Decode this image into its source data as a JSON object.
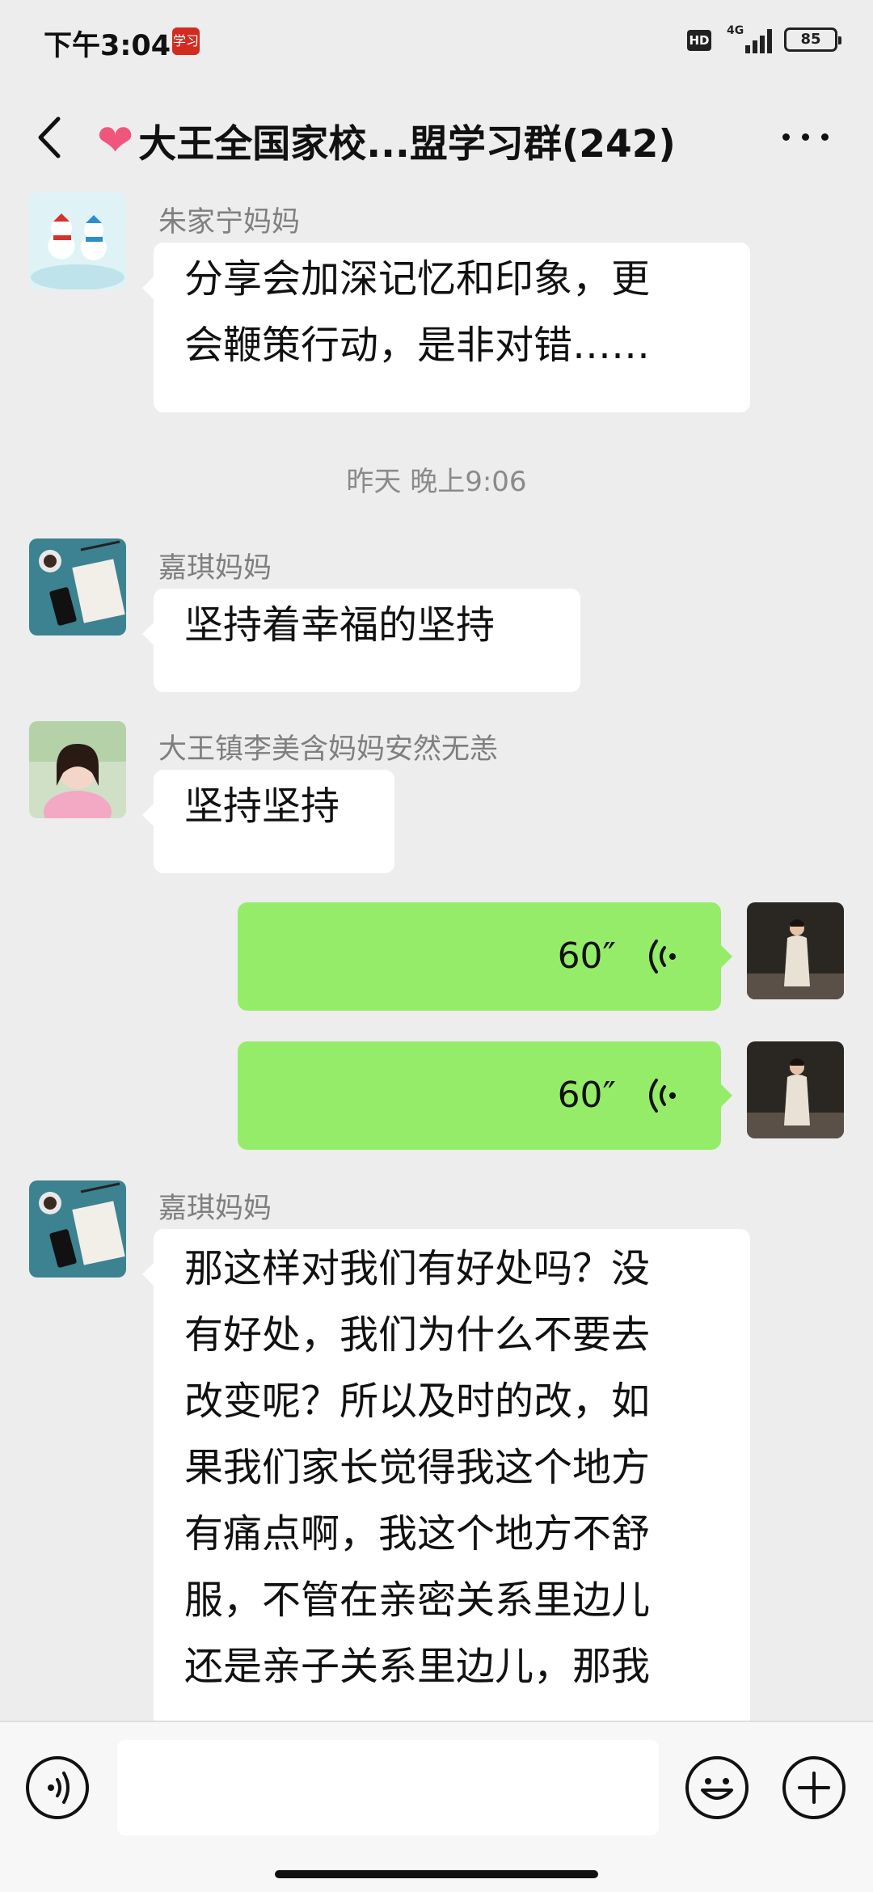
{
  "status_bar": {
    "time": "下午3:04",
    "app_badge": "学习",
    "hd": "HD",
    "network": "4G",
    "battery": "85"
  },
  "header": {
    "title": "大王全国家校...盟学习群(242)"
  },
  "messages": [
    {
      "sender": "朱家宁妈妈",
      "lines": [
        "分享会加深记忆和印象，更",
        "会鞭策行动，是非对错……"
      ]
    },
    {
      "sender": "嘉琪妈妈",
      "lines": [
        "坚持着幸福的坚持"
      ]
    },
    {
      "sender": "大王镇李美含妈妈安然无恙",
      "lines": [
        "坚持坚持"
      ]
    },
    {
      "sender": "嘉琪妈妈",
      "lines": [
        "那这样对我们有好处吗？没",
        "有好处，我们为什么不要去",
        "改变呢？所以及时的改，如",
        "果我们家长觉得我这个地方",
        "有痛点啊，我这个地方不舒",
        "服，不管在亲密关系里边儿",
        "还是亲子关系里边儿，那我"
      ]
    }
  ],
  "timestamp": "昨天 晚上9:06",
  "voice_messages": [
    {
      "duration": "60″"
    },
    {
      "duration": "60″"
    }
  ],
  "colors": {
    "voice_bubble": "#95ec69",
    "background": "#ededed"
  }
}
